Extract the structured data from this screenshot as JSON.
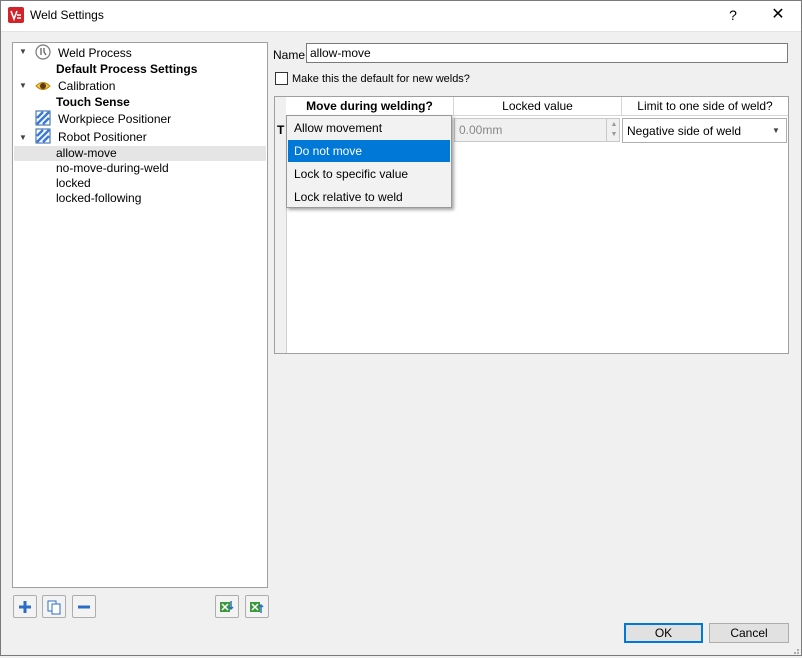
{
  "window": {
    "title": "Weld Settings",
    "help": "?",
    "close": "✕"
  },
  "tree": {
    "weld_process": "Weld Process",
    "default_process_settings": "Default Process Settings",
    "calibration": "Calibration",
    "touch_sense": "Touch Sense",
    "workpiece_positioner": "Workpiece Positioner",
    "robot_positioner": "Robot Positioner",
    "children": [
      "allow-move",
      "no-move-during-weld",
      "locked",
      "locked-following"
    ]
  },
  "form": {
    "name_label": "Name",
    "name_value": "allow-move",
    "default_label": "Make this the default for new welds?"
  },
  "grid": {
    "headers": [
      "Move during welding?",
      "Locked value",
      "Limit to one side of weld?"
    ],
    "row_label": "T",
    "locked_value": "0.00mm",
    "limit_value": "Negative side of weld"
  },
  "dropdown": {
    "options": [
      "Allow movement",
      "Do not move",
      "Lock to specific value",
      "Lock relative to weld"
    ],
    "highlighted_index": 1
  },
  "footer": {
    "ok": "OK",
    "cancel": "Cancel"
  },
  "colors": {
    "accent": "#0078d7",
    "brand": "#d2232a"
  }
}
